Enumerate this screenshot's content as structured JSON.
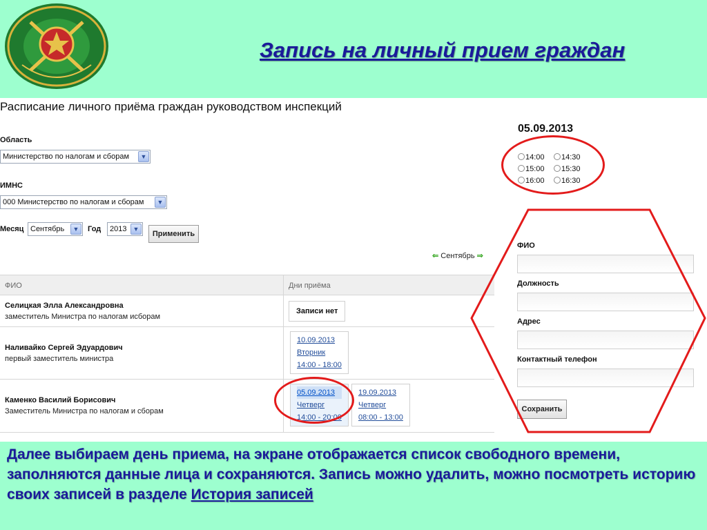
{
  "slide": {
    "title": "Запись на личный прием граждан",
    "caption": "Далее выбираем день приема, на экране отображается список свободного времени, заполняются данные лица и сохраняются. Запись можно удалить, можно посмотреть историю своих записей   в разделе",
    "caption_link": "История записей"
  },
  "page": {
    "title": "Расписание личного приёма граждан руководством инспекций",
    "filters": {
      "region_label": "Область",
      "region_value": "Министерство по налогам и сборам",
      "imns_label": "ИМНС",
      "imns_value": "000 Министерство по налогам и сборам",
      "month_label": "Месяц",
      "month_value": "Сентябрь",
      "year_label": "Год",
      "year_value": "2013",
      "apply_button": "Применить"
    },
    "month_nav": "Сентябрь",
    "table": {
      "headers": [
        "ФИО",
        "Дни приёма"
      ],
      "rows": [
        {
          "name": "Селицкая Элла Александровна",
          "position": "заместитель Министра по налогам исборам",
          "no_records": "Записи нет"
        },
        {
          "name": "Наливайко Сергей Эдуардович",
          "position": "первый заместитель министра",
          "days": [
            {
              "date": "10.09.2013",
              "weekday": "Вторник",
              "time": "14:00 - 18:00"
            }
          ]
        },
        {
          "name": "Каменко Василий Борисович",
          "position": "Заместитель Министра по налогам и сборам",
          "days": [
            {
              "date": "05.09.2013",
              "weekday": "Четверг",
              "time": "14:00 - 20:00"
            },
            {
              "date": "19.09.2013",
              "weekday": "Четверг",
              "time": "08:00 - 13:00"
            }
          ]
        }
      ]
    },
    "selected_date": "05.09.2013",
    "time_slots": [
      "14:00",
      "14:30",
      "15:00",
      "15:30",
      "16:00",
      "16:30"
    ],
    "form": {
      "fio_label": "ФИО",
      "position_label": "Должность",
      "address_label": "Адрес",
      "phone_label": "Контактный телефон",
      "save_button": "Сохранить"
    }
  },
  "colors": {
    "slide_background": "#9dffcf",
    "title_text": "#1a1a9a",
    "annotation_red": "#e31b1b"
  },
  "icons": {
    "emblem": "emblem-icon",
    "arrow_left": "arrow-left-icon",
    "arrow_right": "arrow-right-icon",
    "dropdown": "chevron-down-icon"
  }
}
